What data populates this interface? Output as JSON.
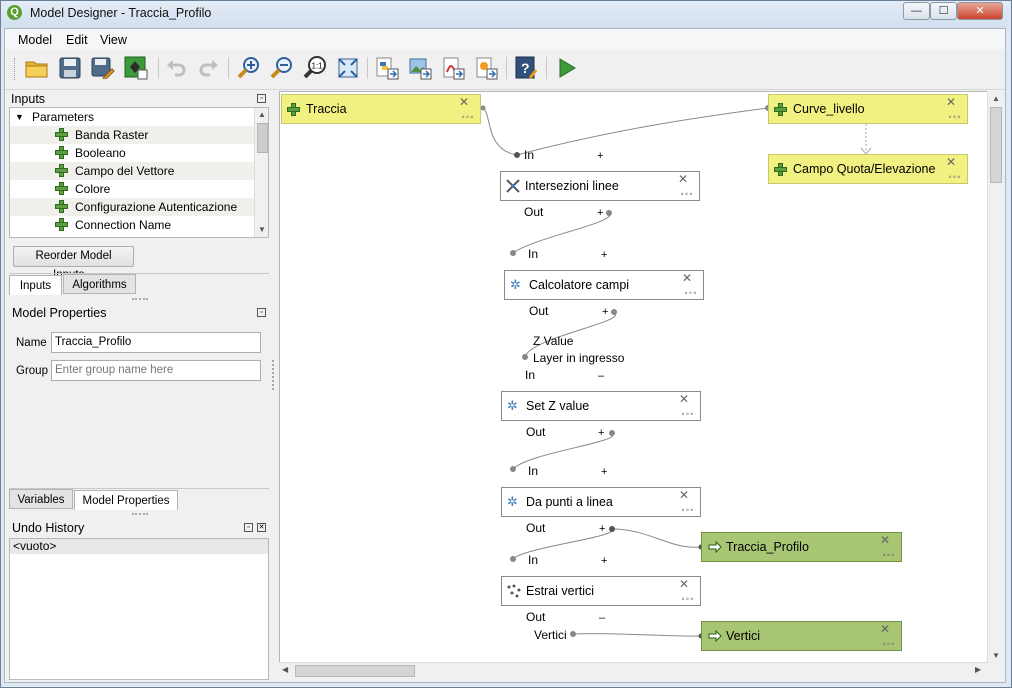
{
  "window": {
    "title": "Model Designer - Traccia_Profilo",
    "app_icon": "qgis-icon",
    "controls": [
      "minimize-icon",
      "maximize-icon",
      "close-icon"
    ]
  },
  "menu": [
    "Model",
    "Edit",
    "View"
  ],
  "toolbar": [
    "open-folder-icon",
    "save-icon",
    "save-as-icon",
    "export-to-processing-icon",
    "undo-icon",
    "redo-icon",
    "zoom-in-icon",
    "zoom-out-icon",
    "zoom-actual-icon",
    "zoom-full-icon",
    "export-python-icon",
    "export-image-icon",
    "export-pdf-icon",
    "export-svg-icon",
    "help-icon",
    "run-icon"
  ],
  "inputs_panel": {
    "title": "Inputs",
    "group": "Parameters",
    "items": [
      "Banda Raster",
      "Booleano",
      "Campo del Vettore",
      "Colore",
      "Configurazione Autenticazione",
      "Connection Name"
    ],
    "reorder_button": "Reorder Model Inputs...",
    "tabs": [
      "Inputs",
      "Algorithms"
    ]
  },
  "model_properties": {
    "title": "Model Properties",
    "name_label": "Name",
    "name_value": "Traccia_Profilo",
    "group_label": "Group",
    "group_placeholder": "Enter group name here",
    "tabs": [
      "Variables",
      "Model Properties"
    ]
  },
  "undo_history": {
    "title": "Undo History",
    "items": [
      "<vuoto>"
    ]
  },
  "canvas": {
    "inputs": [
      "Traccia",
      "Curve_livello",
      "Campo Quota/Elevazione"
    ],
    "algorithms": [
      {
        "name": "Intersezioni linee",
        "in": "In",
        "out": "Out",
        "in_toggle": "+",
        "out_toggle": "+"
      },
      {
        "name": "Calcolatore campi",
        "in": "In",
        "out": "Out",
        "in_toggle": "–",
        "out_toggle": "+",
        "in_params": [
          "Z Value",
          "Layer in ingresso"
        ]
      },
      {
        "name": "Set Z value",
        "in": "In",
        "out": "Out",
        "in_toggle": "+",
        "out_toggle": "+"
      },
      {
        "name": "Da punti a linea",
        "in": "In",
        "out": "Out",
        "in_toggle": "+",
        "out_toggle": "+"
      },
      {
        "name": "Estrai vertici",
        "in": "In",
        "out": "Out",
        "out_toggle": "–",
        "out_params": [
          "Vertici"
        ]
      }
    ],
    "first_in_label": "In",
    "first_in_toggle": "+",
    "outputs": [
      "Traccia_Profilo",
      "Vertici"
    ],
    "close_glyph": "✕",
    "dots_glyph": "∘∘∘"
  }
}
